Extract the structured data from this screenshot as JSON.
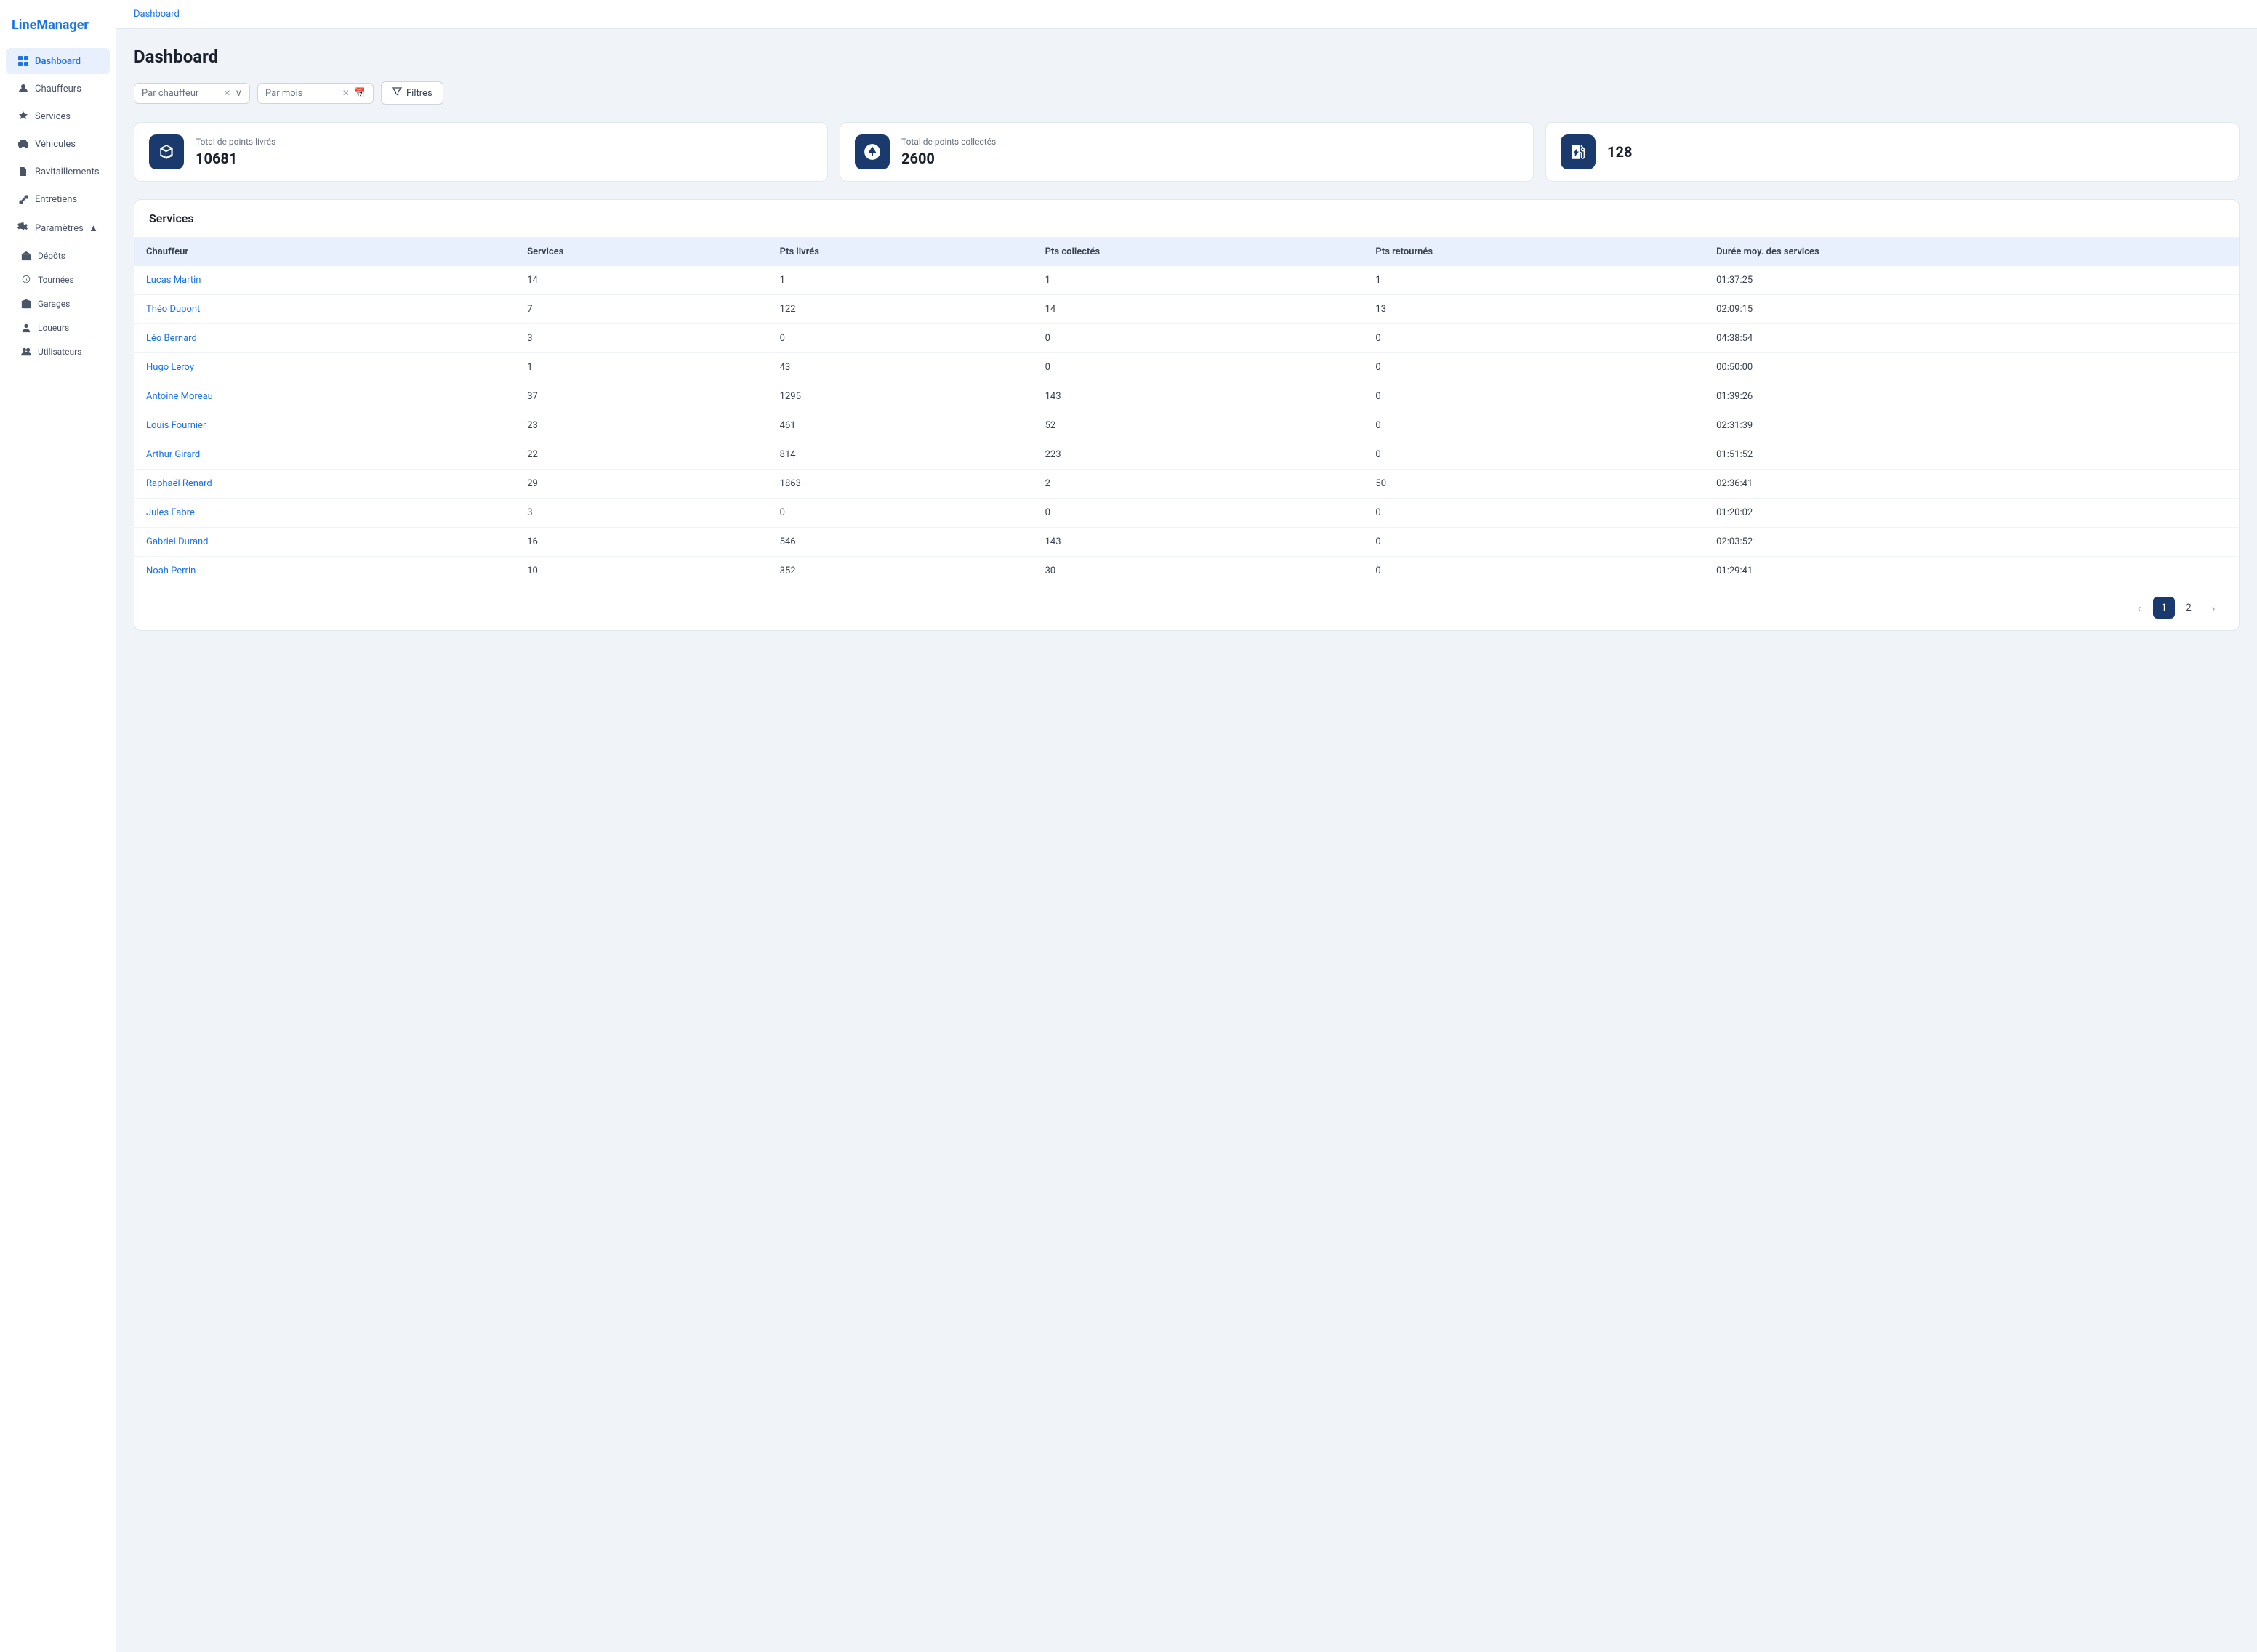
{
  "brand": "LineManager",
  "topbar": {
    "breadcrumb": "Dashboard"
  },
  "page": {
    "title": "Dashboard"
  },
  "sidebar": {
    "items": [
      {
        "id": "dashboard",
        "label": "Dashboard",
        "active": true
      },
      {
        "id": "chauffeurs",
        "label": "Chauffeurs",
        "active": false
      },
      {
        "id": "services",
        "label": "Services",
        "active": false
      },
      {
        "id": "vehicules",
        "label": "Véhicules",
        "active": false
      },
      {
        "id": "ravitaillements",
        "label": "Ravitaillements",
        "active": false
      },
      {
        "id": "entretiens",
        "label": "Entretiens",
        "active": false
      }
    ],
    "params_label": "Paramètres",
    "params_sub": [
      {
        "id": "depots",
        "label": "Dépôts"
      },
      {
        "id": "tournees",
        "label": "Tournées"
      },
      {
        "id": "garages",
        "label": "Garages"
      },
      {
        "id": "loueurs",
        "label": "Loueurs"
      },
      {
        "id": "utilisateurs",
        "label": "Utilisateurs"
      }
    ]
  },
  "filters": {
    "driver_placeholder": "Par chauffeur",
    "month_placeholder": "Par mois",
    "filter_btn": "Filtres"
  },
  "stats": [
    {
      "label": "Total de points livrés",
      "value": "10681",
      "icon": "box"
    },
    {
      "label": "Total de points collectés",
      "value": "2600",
      "icon": "recycle"
    },
    {
      "label": "",
      "value": "128",
      "icon": "fuel"
    }
  ],
  "services_section": {
    "title": "Services",
    "columns": [
      "Chauffeur",
      "Services",
      "Pts livrés",
      "Pts collectés",
      "Pts retournés",
      "Durée moy. des services"
    ],
    "rows": [
      {
        "name": "Lucas Martin",
        "services": "14",
        "pts_livres": "1",
        "pts_collectes": "1",
        "pts_retournes": "1",
        "duree": "01:37:25"
      },
      {
        "name": "Théo Dupont",
        "services": "7",
        "pts_livres": "122",
        "pts_collectes": "14",
        "pts_retournes": "13",
        "duree": "02:09:15"
      },
      {
        "name": "Léo Bernard",
        "services": "3",
        "pts_livres": "0",
        "pts_collectes": "0",
        "pts_retournes": "0",
        "duree": "04:38:54"
      },
      {
        "name": "Hugo Leroy",
        "services": "1",
        "pts_livres": "43",
        "pts_collectes": "0",
        "pts_retournes": "0",
        "duree": "00:50:00"
      },
      {
        "name": "Antoine Moreau",
        "services": "37",
        "pts_livres": "1295",
        "pts_collectes": "143",
        "pts_retournes": "0",
        "duree": "01:39:26"
      },
      {
        "name": "Louis Fournier",
        "services": "23",
        "pts_livres": "461",
        "pts_collectes": "52",
        "pts_retournes": "0",
        "duree": "02:31:39"
      },
      {
        "name": "Arthur Girard",
        "services": "22",
        "pts_livres": "814",
        "pts_collectes": "223",
        "pts_retournes": "0",
        "duree": "01:51:52"
      },
      {
        "name": "Raphaël Renard",
        "services": "29",
        "pts_livres": "1863",
        "pts_collectes": "2",
        "pts_retournes": "50",
        "duree": "02:36:41"
      },
      {
        "name": "Jules Fabre",
        "services": "3",
        "pts_livres": "0",
        "pts_collectes": "0",
        "pts_retournes": "0",
        "duree": "01:20:02"
      },
      {
        "name": "Gabriel Durand",
        "services": "16",
        "pts_livres": "546",
        "pts_collectes": "143",
        "pts_retournes": "0",
        "duree": "02:03:52"
      },
      {
        "name": "Noah Perrin",
        "services": "10",
        "pts_livres": "352",
        "pts_collectes": "30",
        "pts_retournes": "0",
        "duree": "01:29:41"
      }
    ]
  },
  "pagination": {
    "current": 1,
    "total": 2
  }
}
